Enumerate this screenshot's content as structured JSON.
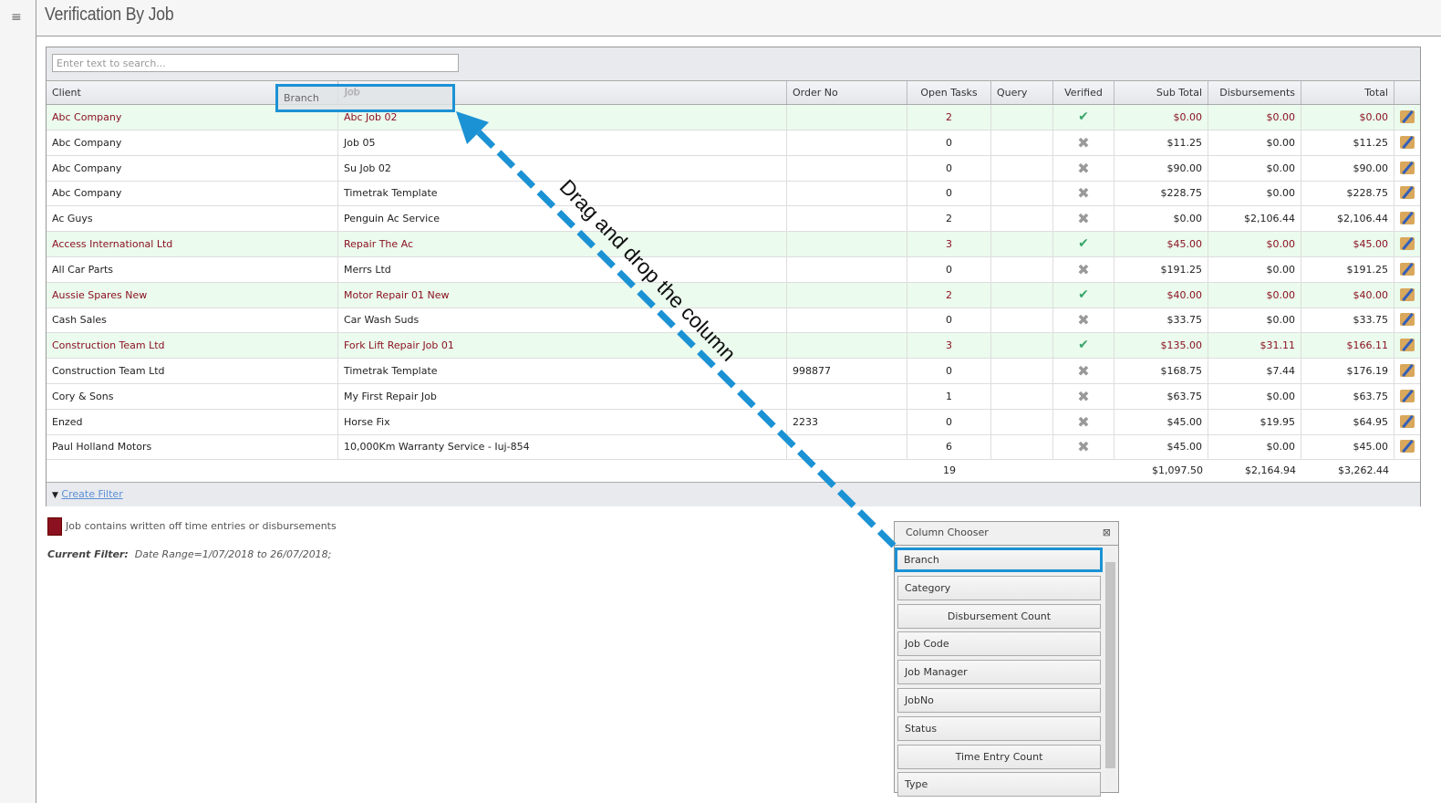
{
  "header": {
    "title": "Verification By Job"
  },
  "search": {
    "placeholder": "Enter text to search..."
  },
  "columns": [
    "Client",
    "Job",
    "Order No",
    "Open Tasks",
    "Query",
    "Verified",
    "Sub Total",
    "Disbursements",
    "Total"
  ],
  "rows": [
    {
      "client": "Abc Company",
      "job": "Abc Job 02",
      "order": "",
      "open": "2",
      "query": "",
      "verified": true,
      "sub": "$0.00",
      "disb": "$0.00",
      "total": "$0.00"
    },
    {
      "client": "Abc Company",
      "job": "Job 05",
      "order": "",
      "open": "0",
      "query": "",
      "verified": false,
      "sub": "$11.25",
      "disb": "$0.00",
      "total": "$11.25"
    },
    {
      "client": "Abc Company",
      "job": "Su Job 02",
      "order": "",
      "open": "0",
      "query": "",
      "verified": false,
      "sub": "$90.00",
      "disb": "$0.00",
      "total": "$90.00"
    },
    {
      "client": "Abc Company",
      "job": "Timetrak Template",
      "order": "",
      "open": "0",
      "query": "",
      "verified": false,
      "sub": "$228.75",
      "disb": "$0.00",
      "total": "$228.75"
    },
    {
      "client": "Ac Guys",
      "job": "Penguin Ac Service",
      "order": "",
      "open": "2",
      "query": "",
      "verified": false,
      "sub": "$0.00",
      "disb": "$2,106.44",
      "total": "$2,106.44"
    },
    {
      "client": "Access International Ltd",
      "job": "Repair The Ac",
      "order": "",
      "open": "3",
      "query": "",
      "verified": true,
      "sub": "$45.00",
      "disb": "$0.00",
      "total": "$45.00"
    },
    {
      "client": "All Car Parts",
      "job": "Merrs Ltd",
      "order": "",
      "open": "0",
      "query": "",
      "verified": false,
      "sub": "$191.25",
      "disb": "$0.00",
      "total": "$191.25"
    },
    {
      "client": "Aussie Spares New",
      "job": "Motor Repair 01 New",
      "order": "",
      "open": "2",
      "query": "",
      "verified": true,
      "sub": "$40.00",
      "disb": "$0.00",
      "total": "$40.00"
    },
    {
      "client": "Cash Sales",
      "job": "Car Wash Suds",
      "order": "",
      "open": "0",
      "query": "",
      "verified": false,
      "sub": "$33.75",
      "disb": "$0.00",
      "total": "$33.75"
    },
    {
      "client": "Construction Team Ltd",
      "job": "Fork Lift Repair Job 01",
      "order": "",
      "open": "3",
      "query": "",
      "verified": true,
      "sub": "$135.00",
      "disb": "$31.11",
      "total": "$166.11"
    },
    {
      "client": "Construction Team Ltd",
      "job": "Timetrak Template",
      "order": "998877",
      "open": "0",
      "query": "",
      "verified": false,
      "sub": "$168.75",
      "disb": "$7.44",
      "total": "$176.19"
    },
    {
      "client": "Cory & Sons",
      "job": "My First Repair Job",
      "order": "",
      "open": "1",
      "query": "",
      "verified": false,
      "sub": "$63.75",
      "disb": "$0.00",
      "total": "$63.75"
    },
    {
      "client": "Enzed",
      "job": "Horse Fix",
      "order": "2233",
      "open": "0",
      "query": "",
      "verified": false,
      "sub": "$45.00",
      "disb": "$19.95",
      "total": "$64.95"
    },
    {
      "client": "Paul Holland Motors",
      "job": "10,000Km Warranty Service - Iuj-854",
      "order": "",
      "open": "6",
      "query": "",
      "verified": false,
      "sub": "$45.00",
      "disb": "$0.00",
      "total": "$45.00"
    }
  ],
  "totals": {
    "open": "19",
    "sub": "$1,097.50",
    "disb": "$2,164.94",
    "total": "$3,262.44"
  },
  "filter": {
    "create": "Create Filter"
  },
  "legend": {
    "text": "Job contains written off time entries or disbursements",
    "color": "#8b1020"
  },
  "current_filter": {
    "label": "Current Filter:",
    "value": "Date Range=1/07/2018 to 26/07/2018;"
  },
  "drag": {
    "column": "Branch",
    "target_header": "Job"
  },
  "annotation": "Drag and drop the column",
  "column_chooser": {
    "title": "Column Chooser",
    "items": [
      "Branch",
      "Category",
      "Disbursement Count",
      "Job Code",
      "Job Manager",
      "JobNo",
      "Status",
      "Time Entry Count",
      "Type"
    ]
  }
}
